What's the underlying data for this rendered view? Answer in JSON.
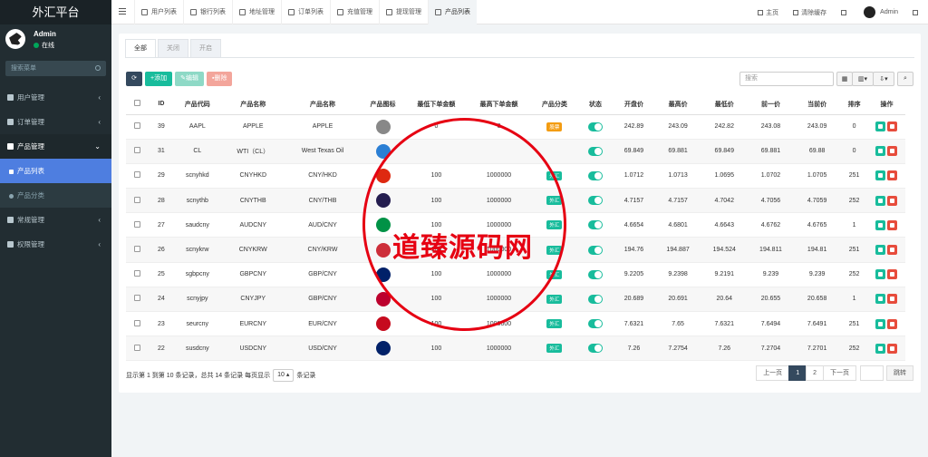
{
  "app": {
    "title": "外汇平台"
  },
  "user": {
    "name": "Admin",
    "status": "在线"
  },
  "sidebar": {
    "search_placeholder": "搜索菜单",
    "items": [
      {
        "label": "用户管理",
        "arrow": "‹"
      },
      {
        "label": "订单管理",
        "arrow": "‹"
      },
      {
        "label": "产品管理",
        "arrow": "⌄"
      },
      {
        "label": "产品列表"
      },
      {
        "label": "产品分类"
      },
      {
        "label": "常规管理",
        "arrow": "‹"
      },
      {
        "label": "权限管理",
        "arrow": "‹"
      }
    ]
  },
  "topbar": {
    "tabs": [
      "用户列表",
      "银行列表",
      "地址管理",
      "订单列表",
      "充值管理",
      "提现管理",
      "产品列表"
    ],
    "home": "主页",
    "clear_cache": "清除缓存",
    "admin": "Admin"
  },
  "content": {
    "tabs": [
      "全部",
      "关闭",
      "开启"
    ],
    "buttons": {
      "add": "添加",
      "edit": "编辑",
      "delete": "删除"
    },
    "search_placeholder": "搜索",
    "headers": [
      "ID",
      "产品代码",
      "产品名称",
      "产品名称",
      "产品图标",
      "最低下单金额",
      "最高下单金额",
      "产品分类",
      "状态",
      "开盘价",
      "最高价",
      "最低价",
      "前一价",
      "当前价",
      "排序",
      "操作"
    ],
    "rows": [
      {
        "id": "39",
        "code": "AAPL",
        "name": "APPLE",
        "name2": "APPLE",
        "flag": "#888888",
        "min": "0",
        "max": "0",
        "cat": "股票",
        "cat_color": "orange",
        "open": "242.89",
        "high": "243.09",
        "low": "242.82",
        "prev": "243.08",
        "cur": "243.09",
        "sort": "0"
      },
      {
        "id": "31",
        "code": "CL",
        "name": "WTI（CL）",
        "name2": "West Texas Oil",
        "flag": "#2b7fd4",
        "min": "",
        "max": "",
        "cat": "",
        "cat_color": "",
        "open": "69.849",
        "high": "69.881",
        "low": "69.849",
        "prev": "69.881",
        "cur": "69.88",
        "sort": "0"
      },
      {
        "id": "29",
        "code": "scnyhkd",
        "name": "CNYHKD",
        "name2": "CNY/HKD",
        "flag": "#de2910",
        "min": "100",
        "max": "1000000",
        "cat": "外汇",
        "cat_color": "green",
        "open": "1.0712",
        "high": "1.0713",
        "low": "1.0695",
        "prev": "1.0702",
        "cur": "1.0705",
        "sort": "251"
      },
      {
        "id": "28",
        "code": "scnythb",
        "name": "CNYTHB",
        "name2": "CNY/THB",
        "flag": "#241d4f",
        "min": "100",
        "max": "1000000",
        "cat": "外汇",
        "cat_color": "green",
        "open": "4.7157",
        "high": "4.7157",
        "low": "4.7042",
        "prev": "4.7056",
        "cur": "4.7059",
        "sort": "252"
      },
      {
        "id": "27",
        "code": "saudcny",
        "name": "AUDCNY",
        "name2": "AUD/CNY",
        "flag": "#009246",
        "min": "100",
        "max": "1000000",
        "cat": "外汇",
        "cat_color": "green",
        "open": "4.6654",
        "high": "4.6801",
        "low": "4.6643",
        "prev": "4.6762",
        "cur": "4.6765",
        "sort": "1"
      },
      {
        "id": "26",
        "code": "scnykrw",
        "name": "CNYKRW",
        "name2": "CNY/KRW",
        "flag": "#cd2e3a",
        "min": "100",
        "max": "1000000",
        "cat": "外汇",
        "cat_color": "green",
        "open": "194.76",
        "high": "194.887",
        "low": "194.524",
        "prev": "194.811",
        "cur": "194.81",
        "sort": "251"
      },
      {
        "id": "25",
        "code": "sgbpcny",
        "name": "GBPCNY",
        "name2": "GBP/CNY",
        "flag": "#012169",
        "min": "100",
        "max": "1000000",
        "cat": "外汇",
        "cat_color": "green",
        "open": "9.2205",
        "high": "9.2398",
        "low": "9.2191",
        "prev": "9.239",
        "cur": "9.239",
        "sort": "252"
      },
      {
        "id": "24",
        "code": "scnyjpy",
        "name": "CNYJPY",
        "name2": "GBP/CNY",
        "flag": "#bc002d",
        "min": "100",
        "max": "1000000",
        "cat": "外汇",
        "cat_color": "green",
        "open": "20.689",
        "high": "20.691",
        "low": "20.64",
        "prev": "20.655",
        "cur": "20.658",
        "sort": "1"
      },
      {
        "id": "23",
        "code": "seurcny",
        "name": "EURCNY",
        "name2": "EUR/CNY",
        "flag": "#c60b1e",
        "min": "100",
        "max": "1000000",
        "cat": "外汇",
        "cat_color": "green",
        "open": "7.6321",
        "high": "7.65",
        "low": "7.6321",
        "prev": "7.6494",
        "cur": "7.6491",
        "sort": "251"
      },
      {
        "id": "22",
        "code": "susdcny",
        "name": "USDCNY",
        "name2": "USD/CNY",
        "flag": "#012169",
        "min": "100",
        "max": "1000000",
        "cat": "外汇",
        "cat_color": "green",
        "open": "7.26",
        "high": "7.2754",
        "low": "7.26",
        "prev": "7.2704",
        "cur": "7.2701",
        "sort": "252"
      }
    ],
    "pager_text_1": "显示第 1 到第 10 条记录，总共 14 条记录 每页显示",
    "pager_size": "10",
    "pager_text_2": "条记录",
    "pager": {
      "prev": "上一页",
      "p1": "1",
      "p2": "2",
      "next": "下一页",
      "jump": "跳转"
    }
  },
  "watermark": {
    "text": "道臻源码网"
  }
}
